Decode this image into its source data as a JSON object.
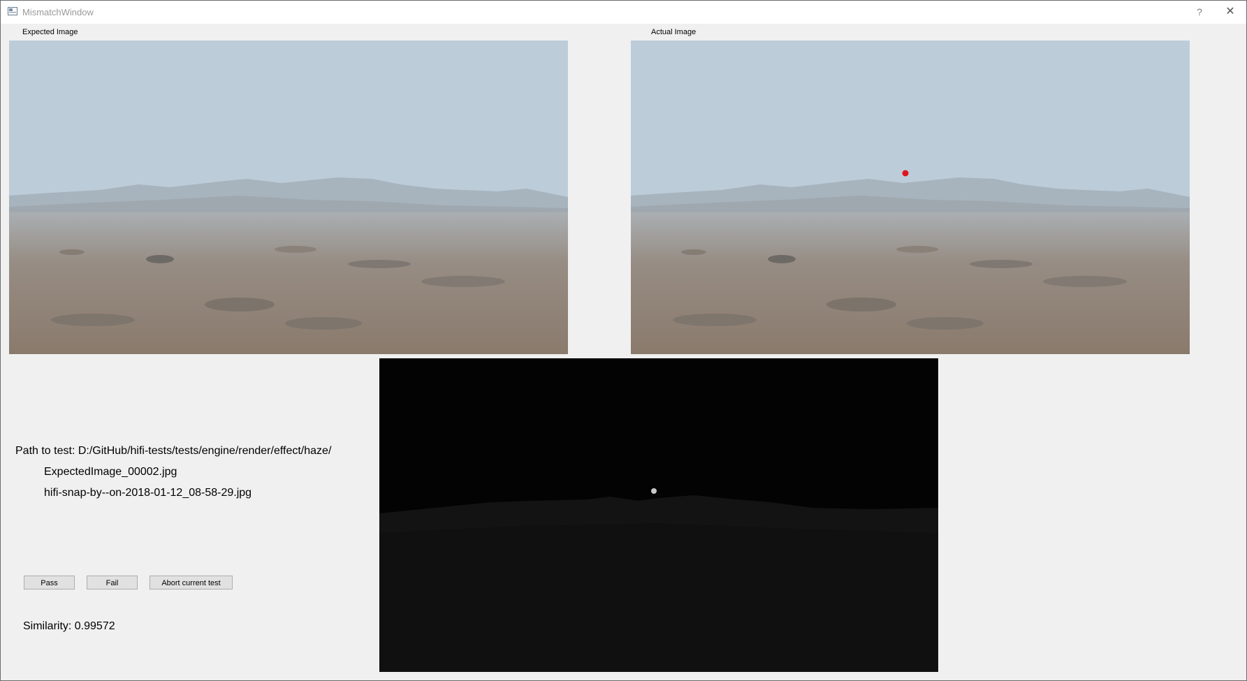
{
  "window": {
    "title": "MismatchWindow",
    "help_symbol": "?",
    "close_symbol": "✕"
  },
  "expected": {
    "label": "Expected Image"
  },
  "actual": {
    "label": "Actual Image"
  },
  "info": {
    "path_line": "Path to test: D:/GitHub/hifi-tests/tests/engine/render/effect/haze/",
    "expected_file": "ExpectedImage_00002.jpg",
    "actual_file": "hifi-snap-by--on-2018-01-12_08-58-29.jpg"
  },
  "buttons": {
    "pass": "Pass",
    "fail": "Fail",
    "abort": "Abort current test"
  },
  "similarity": "Similarity: 0.99572",
  "colors": {
    "sky": "#bccdd9",
    "ground": "#8f8479",
    "marker": "#e0141e",
    "diff_bg": "#030303"
  }
}
